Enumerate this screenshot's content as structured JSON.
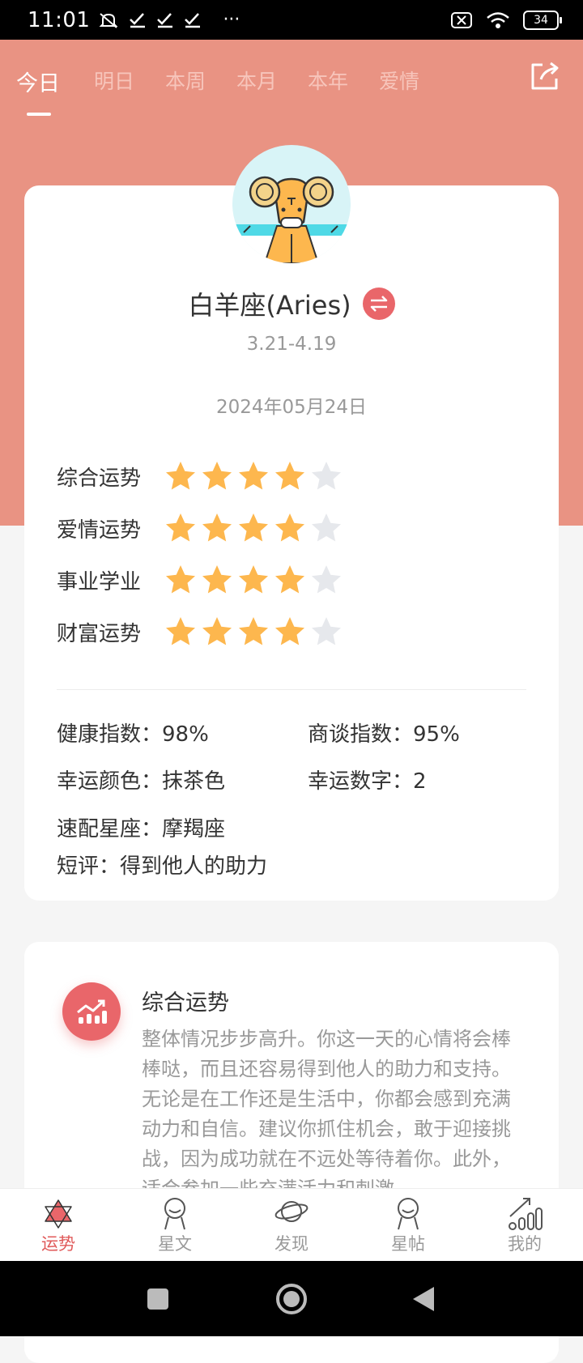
{
  "status_bar": {
    "time": "11:01",
    "extra": "···",
    "battery": "34"
  },
  "tabs": [
    {
      "label": "今日",
      "active": true
    },
    {
      "label": "明日",
      "active": false
    },
    {
      "label": "本周",
      "active": false
    },
    {
      "label": "本月",
      "active": false
    },
    {
      "label": "本年",
      "active": false
    },
    {
      "label": "爱情",
      "active": false
    }
  ],
  "sign": {
    "name": "白羊座(Aries)",
    "date_range": "3.21-4.19",
    "date": "2024年05月24日"
  },
  "ratings": [
    {
      "label": "综合运势",
      "stars": 4,
      "max": 5
    },
    {
      "label": "爱情运势",
      "stars": 4,
      "max": 5
    },
    {
      "label": "事业学业",
      "stars": 4,
      "max": 5
    },
    {
      "label": "财富运势",
      "stars": 4,
      "max": 5
    }
  ],
  "info": {
    "health": "健康指数：98%",
    "business": "商谈指数：95%",
    "lucky_color": "幸运颜色：抹茶色",
    "lucky_number": "幸运数字：2",
    "match": "速配星座：摩羯座",
    "comment": "短评：得到他人的助力"
  },
  "overall": {
    "title": "综合运势",
    "body": "整体情况步步高升。你这一天的心情将会棒棒哒，而且还容易得到他人的助力和支持。无论是在工作还是生活中，你都会感到充满动力和自信。建议你抓住机会，敢于迎接挑战，因为成功就在不远处等待着你。此外，适合参加一些充满活力和刺激"
  },
  "bottom_nav": [
    {
      "label": "运势",
      "active": true,
      "icon": "star-of-david-icon"
    },
    {
      "label": "星文",
      "active": false,
      "icon": "person-icon"
    },
    {
      "label": "发现",
      "active": false,
      "icon": "planet-icon"
    },
    {
      "label": "星帖",
      "active": false,
      "icon": "person-icon"
    },
    {
      "label": "我的",
      "active": false,
      "icon": "chart-icon"
    }
  ],
  "colors": {
    "header": "#e99383",
    "accent": "#e9666a",
    "star": "#fdb74e",
    "star_empty": "#e6e8ec"
  }
}
